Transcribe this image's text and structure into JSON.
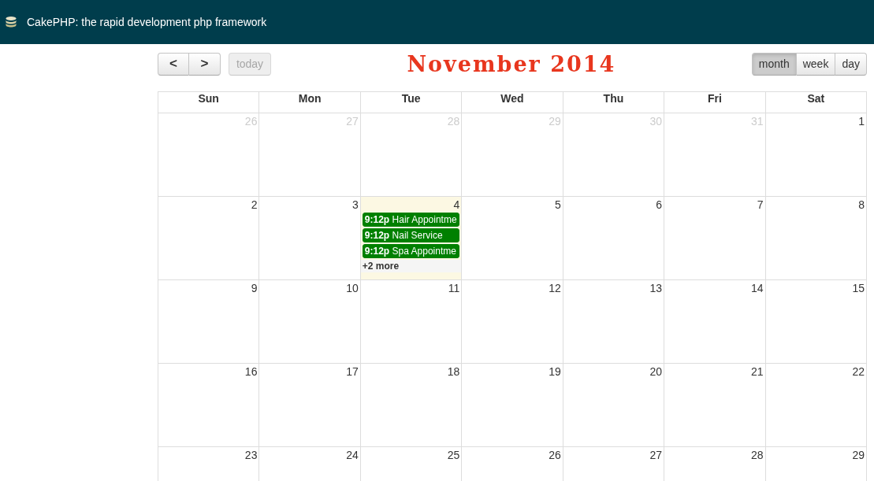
{
  "navbar": {
    "title": "CakePHP: the rapid development php framework"
  },
  "toolbar": {
    "prev": "<",
    "next": ">",
    "today": {
      "label": "today",
      "disabled": true
    },
    "title": "November 2014",
    "views": [
      {
        "label": "month",
        "selected": true
      },
      {
        "label": "week",
        "selected": false
      },
      {
        "label": "day",
        "selected": false
      }
    ]
  },
  "calendar": {
    "weekdays": [
      "Sun",
      "Mon",
      "Tue",
      "Wed",
      "Thu",
      "Fri",
      "Sat"
    ],
    "weeks": [
      [
        {
          "day": "26",
          "other_month": true,
          "today": false
        },
        {
          "day": "27",
          "other_month": true,
          "today": false
        },
        {
          "day": "28",
          "other_month": true,
          "today": false
        },
        {
          "day": "29",
          "other_month": true,
          "today": false
        },
        {
          "day": "30",
          "other_month": true,
          "today": false
        },
        {
          "day": "31",
          "other_month": true,
          "today": false
        },
        {
          "day": "1",
          "other_month": false,
          "today": false
        }
      ],
      [
        {
          "day": "2",
          "other_month": false,
          "today": false
        },
        {
          "day": "3",
          "other_month": false,
          "today": false
        },
        {
          "day": "4",
          "other_month": false,
          "today": true,
          "events": [
            {
              "time": "9:12p",
              "title": "Hair Appointme",
              "color": "#008000"
            },
            {
              "time": "9:12p",
              "title": "Nail Service",
              "color": "#008000"
            },
            {
              "time": "9:12p",
              "title": "Spa Appointme",
              "color": "#008000"
            }
          ],
          "more": "+2 more"
        },
        {
          "day": "5",
          "other_month": false,
          "today": false
        },
        {
          "day": "6",
          "other_month": false,
          "today": false
        },
        {
          "day": "7",
          "other_month": false,
          "today": false
        },
        {
          "day": "8",
          "other_month": false,
          "today": false
        }
      ],
      [
        {
          "day": "9",
          "other_month": false,
          "today": false
        },
        {
          "day": "10",
          "other_month": false,
          "today": false
        },
        {
          "day": "11",
          "other_month": false,
          "today": false
        },
        {
          "day": "12",
          "other_month": false,
          "today": false
        },
        {
          "day": "13",
          "other_month": false,
          "today": false
        },
        {
          "day": "14",
          "other_month": false,
          "today": false
        },
        {
          "day": "15",
          "other_month": false,
          "today": false
        }
      ],
      [
        {
          "day": "16",
          "other_month": false,
          "today": false
        },
        {
          "day": "17",
          "other_month": false,
          "today": false
        },
        {
          "day": "18",
          "other_month": false,
          "today": false
        },
        {
          "day": "19",
          "other_month": false,
          "today": false
        },
        {
          "day": "20",
          "other_month": false,
          "today": false
        },
        {
          "day": "21",
          "other_month": false,
          "today": false
        },
        {
          "day": "22",
          "other_month": false,
          "today": false
        }
      ],
      [
        {
          "day": "23",
          "other_month": false,
          "today": false
        },
        {
          "day": "24",
          "other_month": false,
          "today": false
        },
        {
          "day": "25",
          "other_month": false,
          "today": false
        },
        {
          "day": "26",
          "other_month": false,
          "today": false
        },
        {
          "day": "27",
          "other_month": false,
          "today": false
        },
        {
          "day": "28",
          "other_month": false,
          "today": false
        },
        {
          "day": "29",
          "other_month": false,
          "today": false
        }
      ]
    ]
  }
}
